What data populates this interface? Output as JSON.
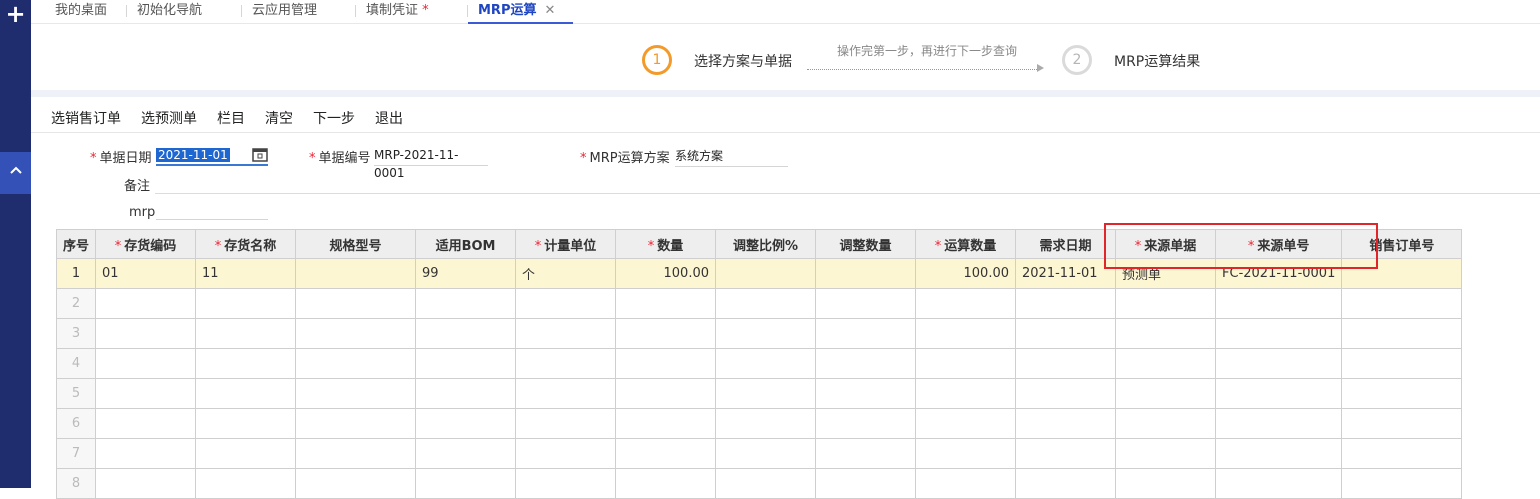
{
  "sidebar": {
    "plus_icon": "plus-icon",
    "collapse_icon": "chevron-up-icon"
  },
  "tabs": [
    {
      "label": "我的桌面",
      "modified": ""
    },
    {
      "label": "初始化导航",
      "modified": ""
    },
    {
      "label": "云应用管理",
      "modified": ""
    },
    {
      "label": "填制凭证",
      "modified": "*"
    },
    {
      "label": "MRP运算",
      "modified": "",
      "active": true
    }
  ],
  "wizard": {
    "step1_num": "1",
    "step1_label": "选择方案与单据",
    "hint": "操作完第一步，再进行下一步查询",
    "step2_num": "2",
    "step2_label": "MRP运算结果",
    "active_color": "#f39a2a"
  },
  "toolbar": [
    "选销售订单",
    "选预测单",
    "栏目",
    "清空",
    "下一步",
    "退出"
  ],
  "form": {
    "date_label": "单据日期",
    "date_value": "2021-11-01",
    "no_label": "单据编号",
    "no_value": "MRP-2021-11-0001",
    "plan_label": "MRP运算方案",
    "plan_value": "系统方案",
    "remark_label": "备注",
    "remark_value": "",
    "mrp_label": "mrp",
    "mrp_value": ""
  },
  "grid": {
    "columns": [
      {
        "label": "序号",
        "required": false
      },
      {
        "label": "存货编码",
        "required": true
      },
      {
        "label": "存货名称",
        "required": true
      },
      {
        "label": "规格型号",
        "required": false
      },
      {
        "label": "适用BOM",
        "required": false
      },
      {
        "label": "计量单位",
        "required": true
      },
      {
        "label": "数量",
        "required": true
      },
      {
        "label": "调整比例%",
        "required": false
      },
      {
        "label": "调整数量",
        "required": false
      },
      {
        "label": "运算数量",
        "required": true
      },
      {
        "label": "需求日期",
        "required": false
      },
      {
        "label": "来源单据",
        "required": true
      },
      {
        "label": "来源单号",
        "required": true
      },
      {
        "label": "销售订单号",
        "required": false
      }
    ],
    "rows": [
      [
        "1",
        "01",
        "11",
        "",
        "99",
        "个",
        "100.00",
        "",
        "",
        "100.00",
        "2021-11-01",
        "预测单",
        "FC-2021-11-0001",
        ""
      ],
      [
        "2",
        "",
        "",
        "",
        "",
        "",
        "",
        "",
        "",
        "",
        "",
        "",
        "",
        ""
      ],
      [
        "3",
        "",
        "",
        "",
        "",
        "",
        "",
        "",
        "",
        "",
        "",
        "",
        "",
        ""
      ],
      [
        "4",
        "",
        "",
        "",
        "",
        "",
        "",
        "",
        "",
        "",
        "",
        "",
        "",
        ""
      ],
      [
        "5",
        "",
        "",
        "",
        "",
        "",
        "",
        "",
        "",
        "",
        "",
        "",
        "",
        ""
      ],
      [
        "6",
        "",
        "",
        "",
        "",
        "",
        "",
        "",
        "",
        "",
        "",
        "",
        "",
        ""
      ],
      [
        "7",
        "",
        "",
        "",
        "",
        "",
        "",
        "",
        "",
        "",
        "",
        "",
        "",
        ""
      ],
      [
        "8",
        "",
        "",
        "",
        "",
        "",
        "",
        "",
        "",
        "",
        "",
        "",
        "",
        ""
      ]
    ]
  },
  "colors": {
    "sidebar": "#1f2d6e",
    "accent": "#3a5ad6",
    "required": "#e23333",
    "highlight": "#e0262a"
  }
}
